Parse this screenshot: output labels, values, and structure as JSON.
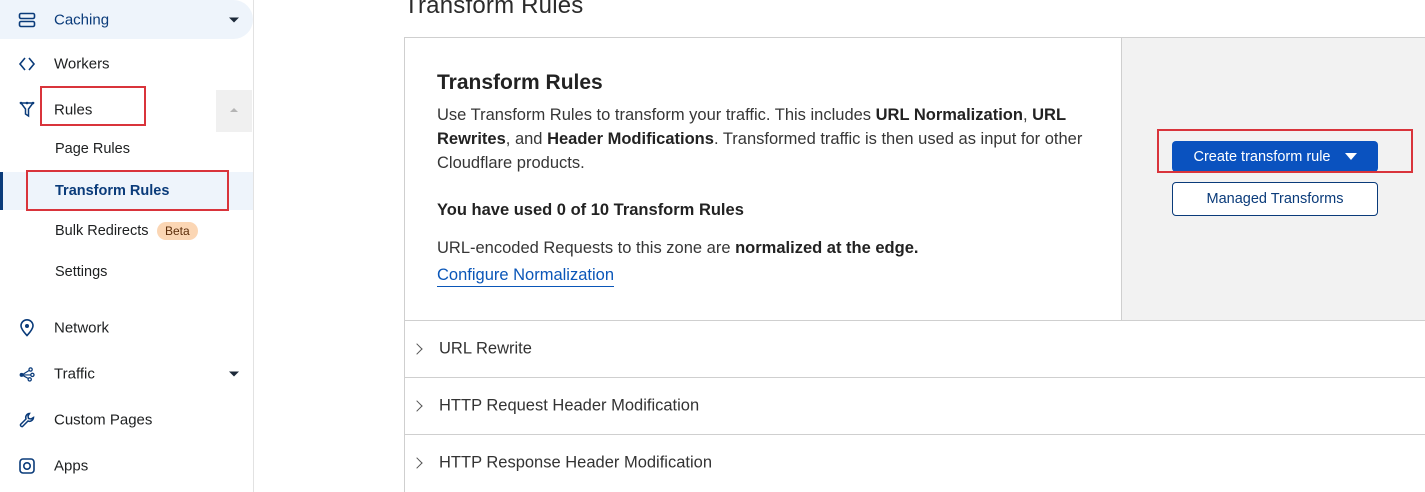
{
  "sidebar": {
    "items": [
      {
        "label": "Caching",
        "icon": "server-stack-icon"
      },
      {
        "label": "Workers",
        "icon": "code-brackets-icon"
      },
      {
        "label": "Rules",
        "icon": "funnel-icon"
      },
      {
        "label": "Network",
        "icon": "location-pin-icon"
      },
      {
        "label": "Traffic",
        "icon": "nodes-icon"
      },
      {
        "label": "Custom Pages",
        "icon": "wrench-icon"
      },
      {
        "label": "Apps",
        "icon": "camera-square-icon"
      }
    ],
    "rules_subitems": [
      {
        "label": "Page Rules"
      },
      {
        "label": "Transform Rules",
        "active": true
      },
      {
        "label": "Bulk Redirects",
        "badge": "Beta"
      },
      {
        "label": "Settings"
      }
    ]
  },
  "main": {
    "heading": "Transform Rules",
    "card": {
      "title": "Transform Rules",
      "desc_pre": "Use Transform Rules to transform your traffic. This includes ",
      "desc_b1": "URL Normalization",
      "desc_mid1": ", ",
      "desc_b2": "URL Rewrites",
      "desc_mid2": ", and ",
      "desc_b3": "Header Modifications",
      "desc_post": ". Transformed traffic is then used as input for other Cloudflare products.",
      "usage": "You have used 0 of 10 Transform Rules",
      "norm_pre": "URL-encoded Requests to this zone are ",
      "norm_bold": "normalized at the edge.",
      "norm_link": "Configure Normalization",
      "create_button": "Create transform rule",
      "managed_button": "Managed Transforms"
    },
    "accordions": [
      {
        "label": "URL Rewrite"
      },
      {
        "label": "HTTP Request Header Modification"
      },
      {
        "label": "HTTP Response Header Modification"
      }
    ]
  },
  "colors": {
    "accent": "#0a52bf",
    "highlight": "#d9343b",
    "active_bg": "#eef4fb",
    "badge_bg": "#fbd6b4"
  }
}
